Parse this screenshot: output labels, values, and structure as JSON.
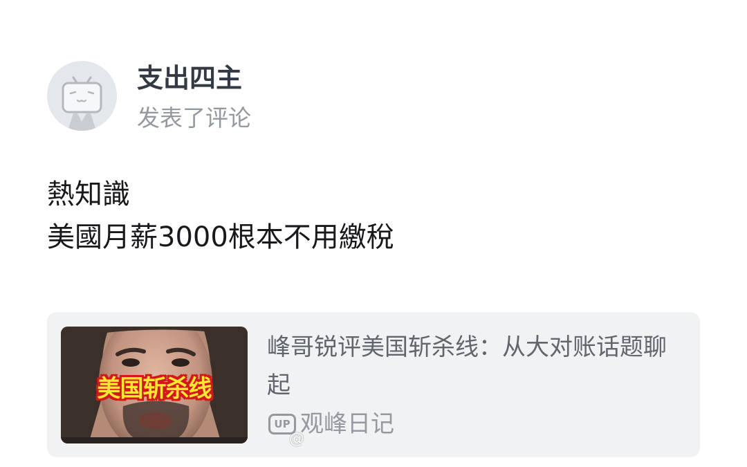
{
  "post": {
    "username": "支出四主",
    "action": "发表了评论",
    "body_lines": [
      "熱知識",
      "美國月薪3000根本不用繳稅"
    ]
  },
  "video_card": {
    "thumbnail_caption": "美国斩杀线",
    "title": "峰哥锐评美国斩杀线：从大对账话题聊起",
    "up_badge": "UP",
    "uploader": "观峰日记"
  },
  "watermark": "@",
  "colors": {
    "username": "#333a44",
    "secondary_text": "#9499a0",
    "card_background": "#f1f2f3",
    "caption_fill": "#ffe633",
    "caption_outline": "#d31818"
  },
  "icons": {
    "avatar": "bilibili-tv-mascot-icon",
    "uploader_badge": "up-badge-icon"
  }
}
